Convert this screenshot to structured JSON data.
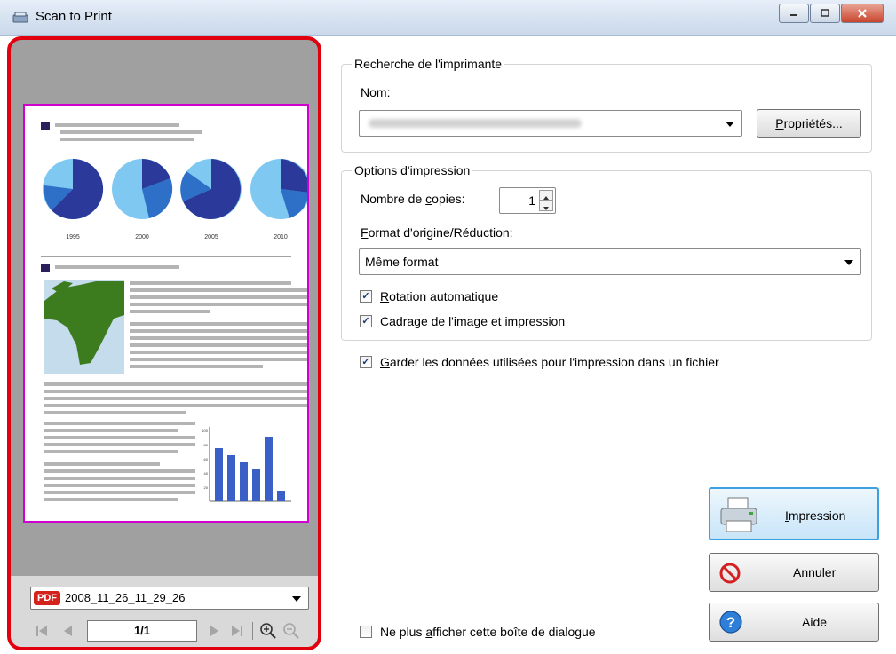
{
  "window": {
    "title": "Scan to Print",
    "controls": [
      "minimize",
      "maximize",
      "close"
    ]
  },
  "preview": {
    "file_name": "2008_11_26_11_29_26",
    "file_badge": "PDF",
    "page_indicator": "1/1",
    "document": {
      "pie_labels": [
        "1995",
        "2000",
        "2005",
        "2010"
      ],
      "bar_axis_labels": [
        "100",
        "80",
        "60",
        "40",
        "20"
      ],
      "bar_values": [
        75,
        65,
        55,
        45,
        90,
        15
      ],
      "pie_dark_share": [
        0.55,
        0.35,
        0.65,
        0.3
      ]
    }
  },
  "printer_search": {
    "legend": "Recherche de l'imprimante",
    "name_label_prefix": "",
    "name_label_ul": "N",
    "name_label_rest": "om:",
    "properties_ul": "P",
    "properties_rest": "ropriétés..."
  },
  "print_options": {
    "legend": "Options d'impression",
    "copies_label_a": "Nombre de ",
    "copies_label_ul": "c",
    "copies_label_b": "opies:",
    "copies_value": "1",
    "format_label_ul": "F",
    "format_label_rest": "ormat d'origine/Réduction:",
    "format_value": "Même format",
    "rotation_ul": "R",
    "rotation_rest": "otation automatique",
    "crop_a": "Ca",
    "crop_ul": "d",
    "crop_b": "rage de l'image et impression"
  },
  "keep_data": {
    "ul": "G",
    "rest": "arder les données utilisées pour l'impression dans un fichier"
  },
  "buttons": {
    "print_ul": "I",
    "print_rest": "mpression",
    "cancel": "Annuler",
    "help": "Aide"
  },
  "dont_show": {
    "a": "Ne plus ",
    "ul": "a",
    "b": "fficher cette boîte de dialogue"
  },
  "colors": {
    "highlight_border": "#e2000f",
    "page_border": "#d000d0",
    "pie_light": "#7ec8f2",
    "pie_mid": "#2e6fc7",
    "pie_dark": "#2b3a9a",
    "bar": "#3a5fc6",
    "map_land": "#3d7b1f",
    "map_water": "#c4dcec"
  }
}
